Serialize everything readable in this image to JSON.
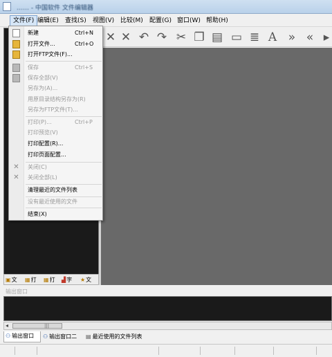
{
  "window": {
    "title": "…… - 中国软件 文件编辑器"
  },
  "menubar": [
    {
      "label": "文件(F)"
    },
    {
      "label": "编辑(E)"
    },
    {
      "label": "查找(S)"
    },
    {
      "label": "视图(V)"
    },
    {
      "label": "比较(M)"
    },
    {
      "label": "配置(G)"
    },
    {
      "label": "窗口(W)"
    },
    {
      "label": "帮助(H)"
    }
  ],
  "file_menu": [
    {
      "label": "新建",
      "shortcut": "Ctrl+N",
      "enabled": true,
      "icon": "new-file-icon"
    },
    {
      "label": "打开文件...",
      "shortcut": "Ctrl+O",
      "enabled": true,
      "icon": "open-folder-icon"
    },
    {
      "label": "打开FTP文件(F)...",
      "shortcut": "",
      "enabled": true,
      "icon": "ftp-open-icon"
    },
    {
      "label": "保存",
      "shortcut": "Ctrl+S",
      "enabled": false,
      "icon": "save-icon"
    },
    {
      "label": "保存全部(V)",
      "shortcut": "",
      "enabled": false,
      "icon": "save-all-icon"
    },
    {
      "label": "另存为(A)...",
      "shortcut": "",
      "enabled": false,
      "icon": ""
    },
    {
      "label": "用原目录结构另存为(R)",
      "shortcut": "",
      "enabled": false,
      "icon": ""
    },
    {
      "label": "另存为FTP文件(T)...",
      "shortcut": "",
      "enabled": false,
      "icon": ""
    },
    {
      "label": "打印(P)...",
      "shortcut": "Ctrl+P",
      "enabled": false,
      "icon": ""
    },
    {
      "label": "打印预览(V)",
      "shortcut": "",
      "enabled": false,
      "icon": ""
    },
    {
      "label": "打印配置(R)...",
      "shortcut": "",
      "enabled": true,
      "icon": ""
    },
    {
      "label": "打印页面配置...",
      "shortcut": "",
      "enabled": true,
      "icon": ""
    },
    {
      "label": "关闭(C)",
      "shortcut": "",
      "enabled": false,
      "icon": "close-icon"
    },
    {
      "label": "关闭全部(L)",
      "shortcut": "",
      "enabled": false,
      "icon": "close-all-icon"
    },
    {
      "label": "清理最近的文件列表",
      "shortcut": "",
      "enabled": true,
      "icon": ""
    },
    {
      "label": "没有最近使用的文件",
      "shortcut": "",
      "enabled": false,
      "icon": ""
    },
    {
      "label": "结束(X)",
      "shortcut": "",
      "enabled": true,
      "icon": ""
    }
  ],
  "sidebar_tabs": [
    {
      "label": "文",
      "icon": "folder-tree-icon"
    },
    {
      "label": "打",
      "icon": "open-doc-icon"
    },
    {
      "label": "打",
      "icon": "open-doc2-icon"
    },
    {
      "label": "字",
      "icon": "chart-icon"
    },
    {
      "label": "文",
      "icon": "star-icon"
    }
  ],
  "output": {
    "title": "输出窗口",
    "tabs": [
      {
        "label": "输出窗口"
      },
      {
        "label": "输出窗口二"
      },
      {
        "label": "最近使用的文件列表"
      }
    ]
  }
}
